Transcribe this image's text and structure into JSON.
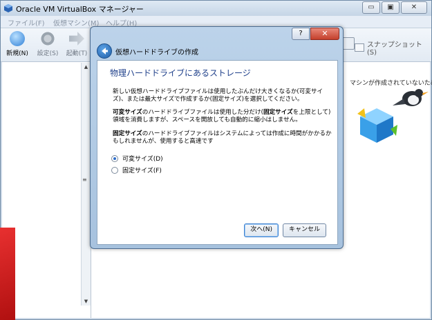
{
  "window": {
    "title": "Oracle VM VirtualBox マネージャー",
    "buttons": {
      "minimize": "▭",
      "restore": "▣",
      "close": "✕"
    }
  },
  "menu": [
    "ファイル(F)",
    "仮想マシン(M)",
    "ヘルプ(H)"
  ],
  "toolbar": {
    "new_label": "新規(N)",
    "settings_label": "設定(S)",
    "start_label": "起動(T)",
    "snapshot_label": "スナップショット(S)"
  },
  "welcome_text": "マシンが作成されていないため、",
  "dialog": {
    "help_glyph": "?",
    "close_glyph": "✕",
    "title": "仮想ハードドライブの作成",
    "heading": "物理ハードドライブにあるストレージ",
    "para1": "新しい仮想ハードドライブファイルは使用したぶんだけ大きくなるか(可変サイズ)、または最大サイズで作成するか(固定サイズ)を選択してください。",
    "para2_term": "可変サイズ",
    "para2_mid": "のハードドライブファイルは使用した分だけ(",
    "para2_term2": "固定サイズ",
    "para2_rest": "を上限として)領域を消費しますが、スペースを開放しても自動的に縮小はしません。",
    "para3_term": "固定サイズ",
    "para3_rest": "のハードドライブファイルはシステムによっては作成に時間がかかるかもしれませんが、使用すると高速です",
    "options": [
      {
        "label": "可変サイズ(D)",
        "checked": true
      },
      {
        "label": "固定サイズ(F)",
        "checked": false
      }
    ],
    "next_label": "次へ(N)",
    "cancel_label": "キャンセル"
  },
  "colors": {
    "accent": "#1e3f8a",
    "titlebar": "#c5d5e6",
    "dialog_frame": "#a7c2de"
  }
}
